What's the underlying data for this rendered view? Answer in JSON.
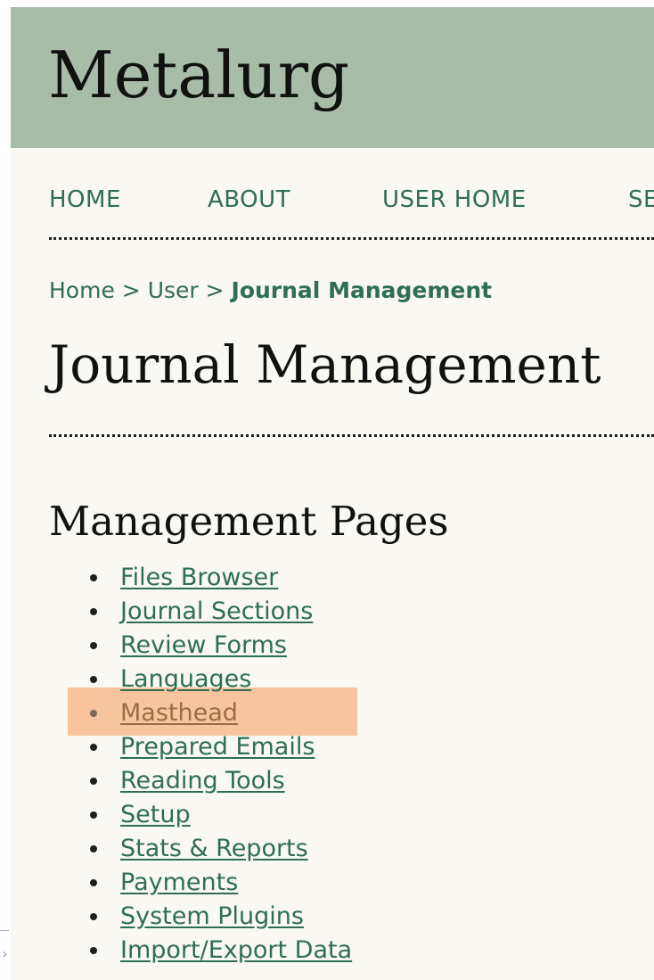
{
  "site": {
    "title": "Metalurg"
  },
  "nav": {
    "items": [
      "HOME",
      "ABOUT",
      "USER HOME",
      "SE"
    ]
  },
  "breadcrumb": {
    "home": "Home",
    "separator": ">",
    "user": "User",
    "current": "Journal Management"
  },
  "page": {
    "title": "Journal Management",
    "section_title": "Management Pages"
  },
  "management_pages": {
    "items": [
      "Files Browser",
      "Journal Sections",
      "Review Forms",
      "Languages",
      "Masthead",
      "Prepared Emails",
      "Reading Tools",
      "Setup",
      "Stats & Reports",
      "Payments",
      "System Plugins",
      "Import/Export Data"
    ],
    "highlighted": "Masthead"
  },
  "colors": {
    "header_bg": "#a9bcaa",
    "page_bg": "#f9f8f2",
    "link": "#2f6e54",
    "highlight": "#f7c49e"
  }
}
